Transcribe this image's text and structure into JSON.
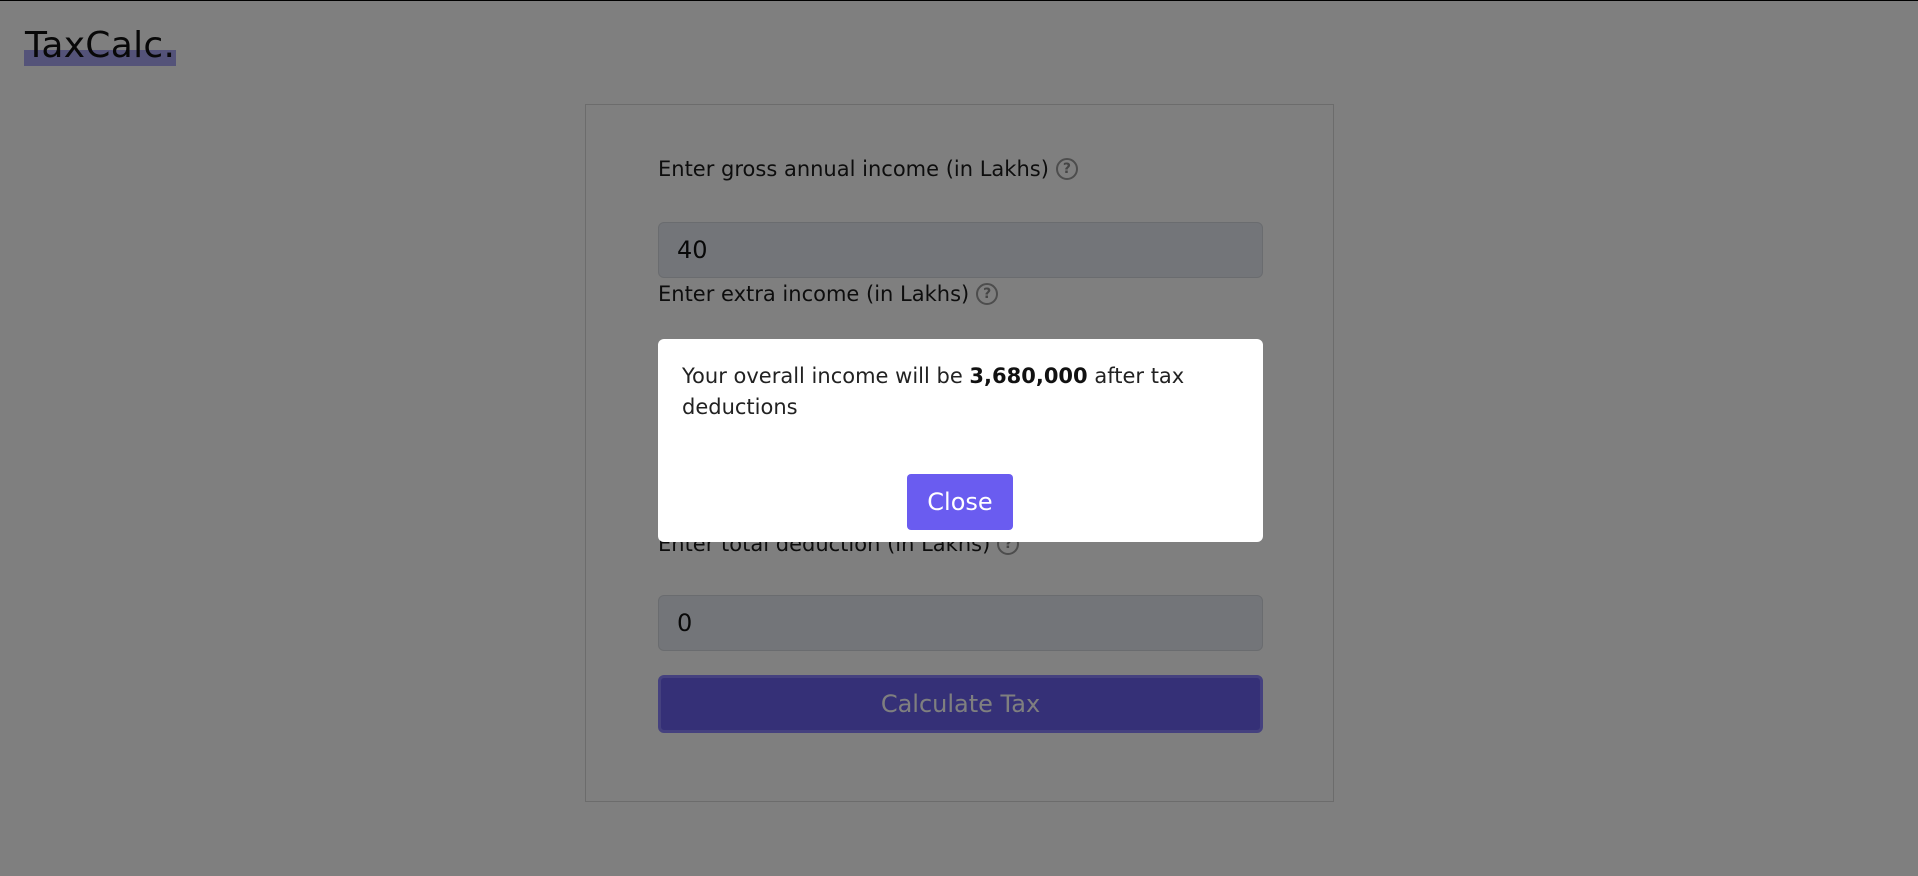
{
  "app": {
    "logo": "TaxCalc."
  },
  "form": {
    "gross_income": {
      "label": "Enter gross annual income (in Lakhs)",
      "value": "40"
    },
    "extra_income": {
      "label": "Enter extra income (in Lakhs)"
    },
    "total_deduction": {
      "label": "Enter total deduction (in Lakhs)",
      "value": "0"
    },
    "help_glyph": "?",
    "submit_label": "Calculate Tax"
  },
  "modal": {
    "text_before": "Your overall income will be ",
    "amount": "3,680,000",
    "text_after": " after tax deductions",
    "close_label": "Close"
  },
  "colors": {
    "accent": "#6b61ee",
    "overlay": "rgba(0,0,0,0.5)"
  }
}
